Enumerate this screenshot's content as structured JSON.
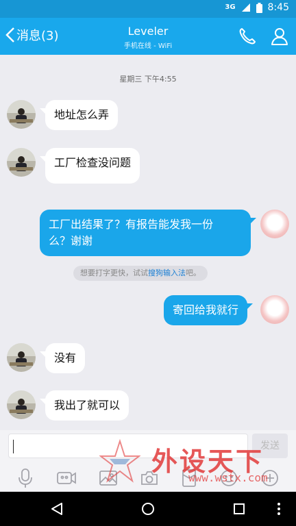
{
  "status_bar": {
    "network": "3G",
    "time": "8:45"
  },
  "header": {
    "back_label": "消息(3)",
    "title": "Leveler",
    "subtitle": "手机在线 - WiFi",
    "call_icon": "phone-icon",
    "profile_icon": "person-icon"
  },
  "chat": {
    "timestamp": "星期三 下午4:55",
    "messages": [
      {
        "from": "other",
        "text": "地址怎么弄"
      },
      {
        "from": "other",
        "text": "工厂检查没问题"
      },
      {
        "from": "me",
        "lines": [
          "工厂出结果了？有报告能发我一份",
          "么？谢谢"
        ]
      },
      {
        "from": "me",
        "text": "寄回给我就行"
      },
      {
        "from": "other",
        "text": "没有"
      },
      {
        "from": "other",
        "text": "我出了就可以"
      }
    ],
    "tip": {
      "prefix": "想要打字更快，试试",
      "link": "搜狗输入法",
      "suffix": "吧。"
    }
  },
  "input_bar": {
    "input_value": "",
    "send_label": "发送",
    "tools": [
      "microphone-icon",
      "video-icon",
      "image-icon",
      "camera-icon",
      "red-packet-icon",
      "emoji-icon",
      "plus-icon"
    ]
  },
  "watermark": {
    "text": "外设天下",
    "url": "www.wstx.com"
  },
  "colors": {
    "header": "#19a8ec",
    "status_bar": "#1796d4",
    "outgoing_bubble": "#1aa6ea",
    "background": "#ececf1"
  }
}
